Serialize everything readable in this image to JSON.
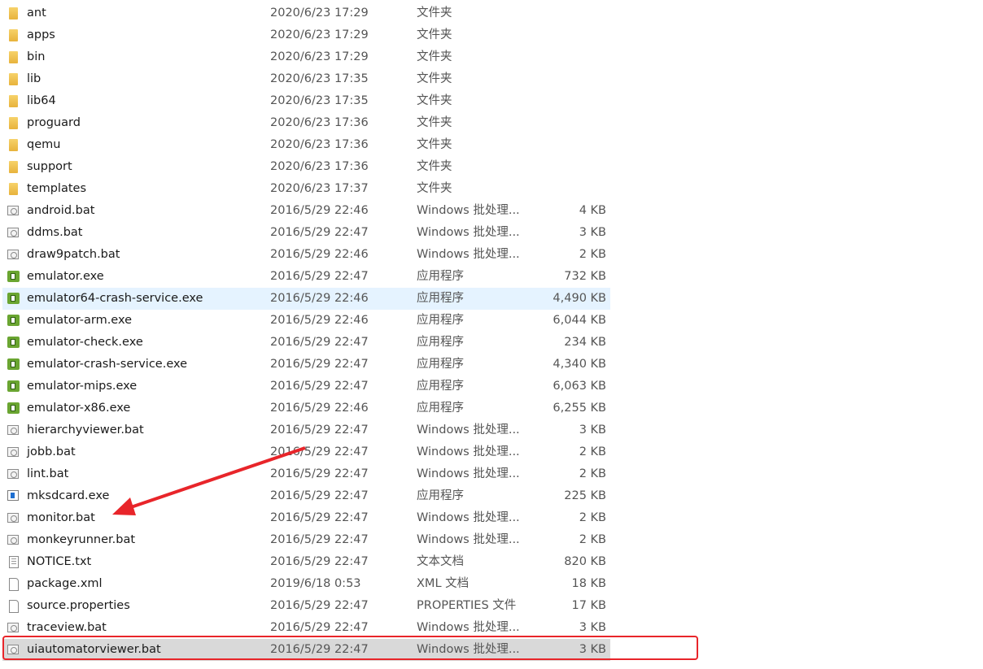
{
  "files": [
    {
      "name": "ant",
      "date": "2020/6/23 17:29",
      "type": "文件夹",
      "size": "",
      "icon": "folder"
    },
    {
      "name": "apps",
      "date": "2020/6/23 17:29",
      "type": "文件夹",
      "size": "",
      "icon": "folder"
    },
    {
      "name": "bin",
      "date": "2020/6/23 17:29",
      "type": "文件夹",
      "size": "",
      "icon": "folder"
    },
    {
      "name": "lib",
      "date": "2020/6/23 17:35",
      "type": "文件夹",
      "size": "",
      "icon": "folder"
    },
    {
      "name": "lib64",
      "date": "2020/6/23 17:35",
      "type": "文件夹",
      "size": "",
      "icon": "folder"
    },
    {
      "name": "proguard",
      "date": "2020/6/23 17:36",
      "type": "文件夹",
      "size": "",
      "icon": "folder"
    },
    {
      "name": "qemu",
      "date": "2020/6/23 17:36",
      "type": "文件夹",
      "size": "",
      "icon": "folder"
    },
    {
      "name": "support",
      "date": "2020/6/23 17:36",
      "type": "文件夹",
      "size": "",
      "icon": "folder"
    },
    {
      "name": "templates",
      "date": "2020/6/23 17:37",
      "type": "文件夹",
      "size": "",
      "icon": "folder"
    },
    {
      "name": "android.bat",
      "date": "2016/5/29 22:46",
      "type": "Windows 批处理...",
      "size": "4 KB",
      "icon": "bat"
    },
    {
      "name": "ddms.bat",
      "date": "2016/5/29 22:47",
      "type": "Windows 批处理...",
      "size": "3 KB",
      "icon": "bat"
    },
    {
      "name": "draw9patch.bat",
      "date": "2016/5/29 22:46",
      "type": "Windows 批处理...",
      "size": "2 KB",
      "icon": "bat"
    },
    {
      "name": "emulator.exe",
      "date": "2016/5/29 22:47",
      "type": "应用程序",
      "size": "732 KB",
      "icon": "exe"
    },
    {
      "name": "emulator64-crash-service.exe",
      "date": "2016/5/29 22:46",
      "type": "应用程序",
      "size": "4,490 KB",
      "icon": "exe",
      "state": "hover"
    },
    {
      "name": "emulator-arm.exe",
      "date": "2016/5/29 22:46",
      "type": "应用程序",
      "size": "6,044 KB",
      "icon": "exe"
    },
    {
      "name": "emulator-check.exe",
      "date": "2016/5/29 22:47",
      "type": "应用程序",
      "size": "234 KB",
      "icon": "exe"
    },
    {
      "name": "emulator-crash-service.exe",
      "date": "2016/5/29 22:47",
      "type": "应用程序",
      "size": "4,340 KB",
      "icon": "exe"
    },
    {
      "name": "emulator-mips.exe",
      "date": "2016/5/29 22:47",
      "type": "应用程序",
      "size": "6,063 KB",
      "icon": "exe"
    },
    {
      "name": "emulator-x86.exe",
      "date": "2016/5/29 22:46",
      "type": "应用程序",
      "size": "6,255 KB",
      "icon": "exe"
    },
    {
      "name": "hierarchyviewer.bat",
      "date": "2016/5/29 22:47",
      "type": "Windows 批处理...",
      "size": "3 KB",
      "icon": "bat"
    },
    {
      "name": "jobb.bat",
      "date": "2016/5/29 22:47",
      "type": "Windows 批处理...",
      "size": "2 KB",
      "icon": "bat"
    },
    {
      "name": "lint.bat",
      "date": "2016/5/29 22:47",
      "type": "Windows 批处理...",
      "size": "2 KB",
      "icon": "bat"
    },
    {
      "name": "mksdcard.exe",
      "date": "2016/5/29 22:47",
      "type": "应用程序",
      "size": "225 KB",
      "icon": "exe2"
    },
    {
      "name": "monitor.bat",
      "date": "2016/5/29 22:47",
      "type": "Windows 批处理...",
      "size": "2 KB",
      "icon": "bat"
    },
    {
      "name": "monkeyrunner.bat",
      "date": "2016/5/29 22:47",
      "type": "Windows 批处理...",
      "size": "2 KB",
      "icon": "bat"
    },
    {
      "name": "NOTICE.txt",
      "date": "2016/5/29 22:47",
      "type": "文本文档",
      "size": "820 KB",
      "icon": "txt"
    },
    {
      "name": "package.xml",
      "date": "2019/6/18 0:53",
      "type": "XML 文档",
      "size": "18 KB",
      "icon": "file"
    },
    {
      "name": "source.properties",
      "date": "2016/5/29 22:47",
      "type": "PROPERTIES 文件",
      "size": "17 KB",
      "icon": "file"
    },
    {
      "name": "traceview.bat",
      "date": "2016/5/29 22:47",
      "type": "Windows 批处理...",
      "size": "3 KB",
      "icon": "bat"
    },
    {
      "name": "uiautomatorviewer.bat",
      "date": "2016/5/29 22:47",
      "type": "Windows 批处理...",
      "size": "3 KB",
      "icon": "bat",
      "state": "selected"
    }
  ],
  "annotations": {
    "arrow_color": "#e8252a",
    "highlight_color": "#e8252a"
  }
}
